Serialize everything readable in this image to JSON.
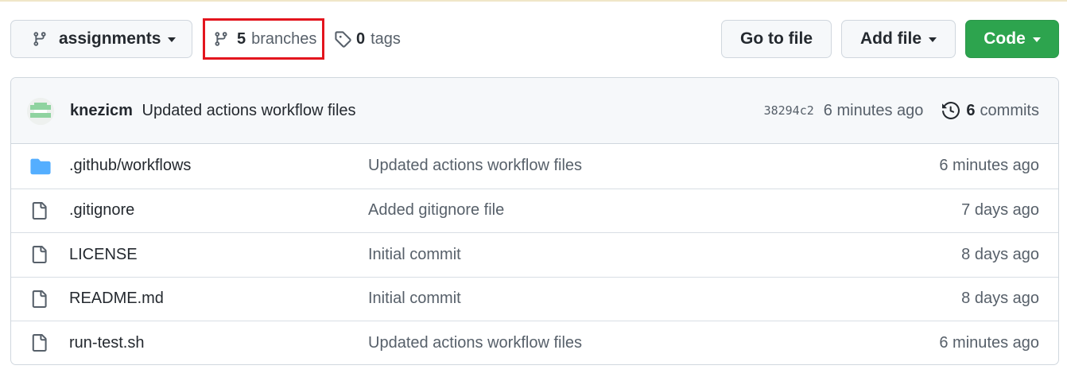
{
  "toolbar": {
    "branch_selector": "assignments",
    "branches_count": "5",
    "branches_label": "branches",
    "tags_count": "0",
    "tags_label": "tags",
    "go_to_file": "Go to file",
    "add_file": "Add file",
    "code": "Code"
  },
  "latest_commit": {
    "author": "knezicm",
    "message": "Updated actions workflow files",
    "sha": "38294c2",
    "time": "6 minutes ago",
    "commits_count": "6",
    "commits_label": "commits"
  },
  "files": [
    {
      "name": ".github/workflows",
      "type": "folder",
      "commit": "Updated actions workflow files",
      "age": "6 minutes ago"
    },
    {
      "name": ".gitignore",
      "type": "file",
      "commit": "Added gitignore file",
      "age": "7 days ago"
    },
    {
      "name": "LICENSE",
      "type": "file",
      "commit": "Initial commit",
      "age": "8 days ago"
    },
    {
      "name": "README.md",
      "type": "file",
      "commit": "Initial commit",
      "age": "8 days ago"
    },
    {
      "name": "run-test.sh",
      "type": "file",
      "commit": "Updated actions workflow files",
      "age": "6 minutes ago"
    }
  ],
  "colors": {
    "highlight_border": "#e3151e",
    "code_button": "#2da44e",
    "folder_icon": "#54aeff"
  },
  "icons": {
    "branch": "git-branch-icon",
    "tag": "tag-icon",
    "history": "history-icon",
    "folder": "folder-icon",
    "file": "file-icon"
  }
}
